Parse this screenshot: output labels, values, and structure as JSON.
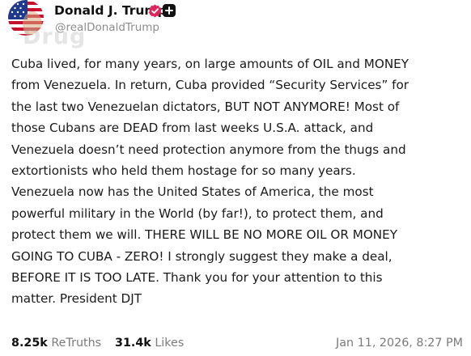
{
  "author": {
    "display_name": "Donald J. Trump",
    "handle": "@realDonaldTrump",
    "verified_icon": "verified-badge-icon",
    "follow_icon": "plus-icon",
    "avatar_icon": "american-flag-avatar"
  },
  "watermark": "Drug",
  "post": {
    "text": "Cuba lived, for many years, on large amounts of OIL and MONEY\nfrom Venezuela. In return, Cuba provided “Security Services” for\nthe last two Venezuelan dictators, BUT NOT ANYMORE! Most of\nthose Cubans are DEAD from last weeks U.S.A. attack, and\nVenezuela doesn’t need protection anymore from the thugs and\nextortionists who held them hostage for so many years.\nVenezuela now has the United States of America, the most\npowerful military in the World (by far!), to protect them, and\nprotect them we will. THERE WILL BE NO MORE OIL OR MONEY\nGOING TO CUBA - ZERO! I strongly suggest they make a deal,\nBEFORE IT IS TOO LATE. Thank you for your attention to this\nmatter. President DJT"
  },
  "stats": {
    "retruths_count": "8.25k",
    "retruths_label": "ReTruths",
    "likes_count": "31.4k",
    "likes_label": "Likes"
  },
  "timestamp": "Jan 11, 2026, 8:27 PM",
  "colors": {
    "verified": "#e0245e",
    "text": "#1a1a1a",
    "muted": "#7a7a7a"
  }
}
